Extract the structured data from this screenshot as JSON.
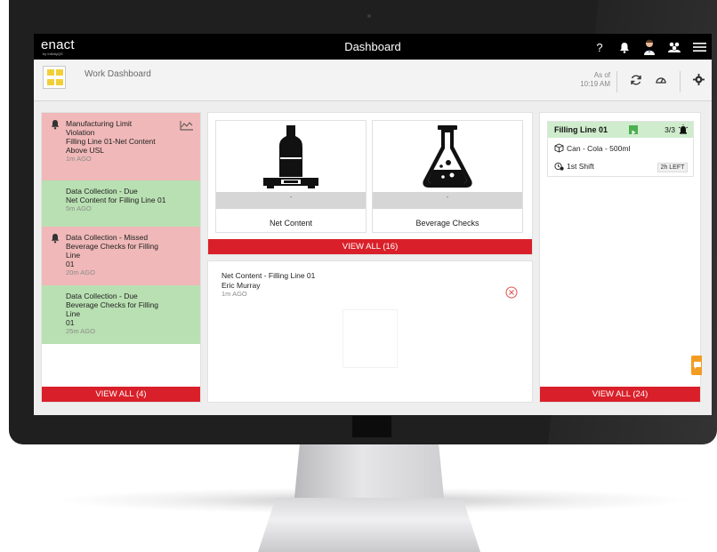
{
  "app": {
    "logo": "enact",
    "logo_sub": "by InfinityQS",
    "title": "Dashboard",
    "help_glyph": "?"
  },
  "subbar": {
    "title": "Work Dashboard",
    "asof_label": "As of",
    "asof_time": "10:19 AM"
  },
  "notifications": {
    "items": [
      {
        "line1": "Manufacturing Limit",
        "line2": "Violation",
        "line3": "Filling Line 01-Net Content",
        "line4": "Above USL",
        "ago": "1m AGO",
        "status": "red"
      },
      {
        "line1": "Data Collection - Due",
        "line2": "Net Content for Filling Line 01",
        "line3": "",
        "line4": "",
        "ago": "5m AGO",
        "status": "green"
      },
      {
        "line1": "Data Collection - Missed",
        "line2": "Beverage Checks for Filling Line",
        "line3": "01",
        "line4": "",
        "ago": "20m AGO",
        "status": "red"
      },
      {
        "line1": "Data Collection - Due",
        "line2": "Beverage Checks for Filling Line",
        "line3": "01",
        "line4": "",
        "ago": "25m AGO",
        "status": "green"
      }
    ],
    "view_all": "VIEW ALL  (4)"
  },
  "collections": {
    "tiles": [
      {
        "label": "Net Content",
        "value": "-",
        "icon": "bottle-on-scale-icon"
      },
      {
        "label": "Beverage Checks",
        "value": "-",
        "icon": "flask-icon"
      }
    ],
    "view_all": "VIEW ALL  (16)"
  },
  "recent": {
    "title": "Net Content - Filling Line 01",
    "user": "Eric Murray",
    "ago": "1m AGO"
  },
  "lines": {
    "name": "Filling Line 01",
    "count": "3/3",
    "product": "Can - Cola - 500ml",
    "shift": "1st Shift",
    "time_left": "2h LEFT",
    "view_all": "VIEW ALL  (24)"
  },
  "colors": {
    "accent_red": "#d9202a",
    "alert_red_bg": "#f0b8b8",
    "ok_green_bg": "#b9e0b2",
    "running_green": "#4caf50",
    "chat_orange": "#f39c24"
  }
}
